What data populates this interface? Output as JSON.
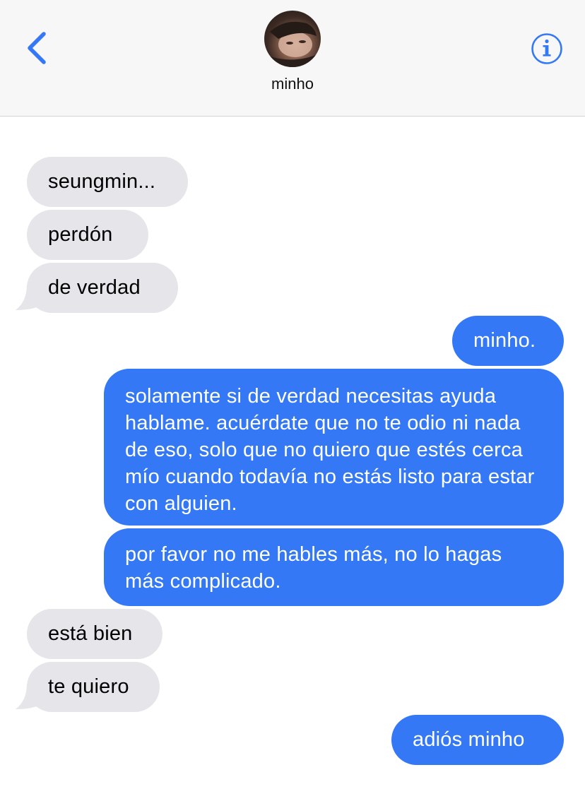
{
  "header": {
    "contact_name": "minho",
    "back_icon": "chevron-left-icon",
    "info_icon": "info-icon",
    "accent_color": "#3478f6"
  },
  "messages": [
    {
      "direction": "incoming",
      "text": "seungmin..."
    },
    {
      "direction": "incoming",
      "text": "perdón"
    },
    {
      "direction": "incoming",
      "text": "de verdad"
    },
    {
      "direction": "outgoing",
      "text": "minho."
    },
    {
      "direction": "outgoing",
      "text": "solamente si de verdad necesitas ayuda hablame. acuérdate que no te odio ni nada de eso, solo que no quiero que estés cerca mío cuando todavía no estás listo para estar con alguien."
    },
    {
      "direction": "outgoing",
      "text": "por favor no me hables más, no lo hagas más complicado."
    },
    {
      "direction": "incoming",
      "text": "está bien"
    },
    {
      "direction": "incoming",
      "text": "te quiero"
    },
    {
      "direction": "outgoing",
      "text": "adiós minho"
    }
  ],
  "colors": {
    "incoming_bubble": "#e5e5ea",
    "outgoing_bubble": "#3478f6",
    "header_bg": "#f7f7f7"
  }
}
